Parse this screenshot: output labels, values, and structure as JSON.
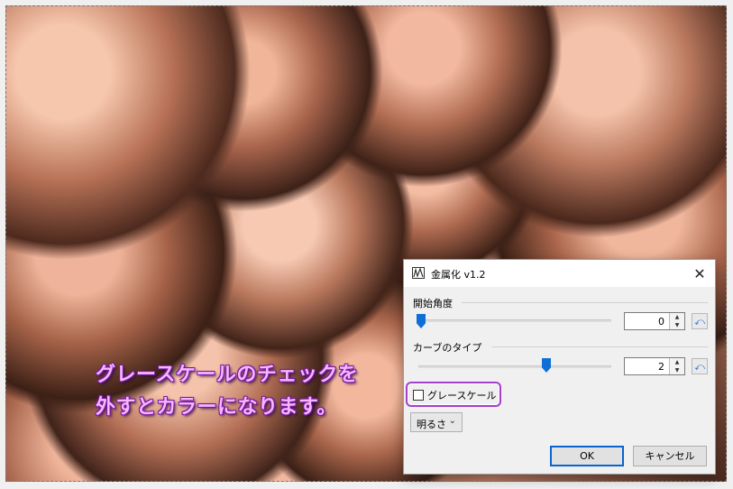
{
  "callout": {
    "line1": "グレースケールのチェックを",
    "line2": "外すとカラーになります。"
  },
  "dialog": {
    "title": "金属化 v1.2",
    "close_glyph": "✕",
    "start_angle": {
      "label": "開始角度",
      "value": "0",
      "slider_fraction": 0.0
    },
    "curve_type": {
      "label": "カーブのタイプ",
      "value": "2",
      "slider_fraction": 0.66
    },
    "grayscale": {
      "label": "グレースケール",
      "checked": false
    },
    "mode_select": {
      "selected": "明るさ"
    },
    "ok_label": "OK",
    "cancel_label": "キャンセル",
    "reset_glyph": "⤺"
  },
  "icons": [
    "app-icon",
    "close-icon",
    "reset-icon",
    "spin-arrows-icon",
    "chevron-down-icon"
  ],
  "colors": {
    "accent": "#0a64d0",
    "highlight": "#a53fcb",
    "callout_text": "#f5b6ff"
  }
}
